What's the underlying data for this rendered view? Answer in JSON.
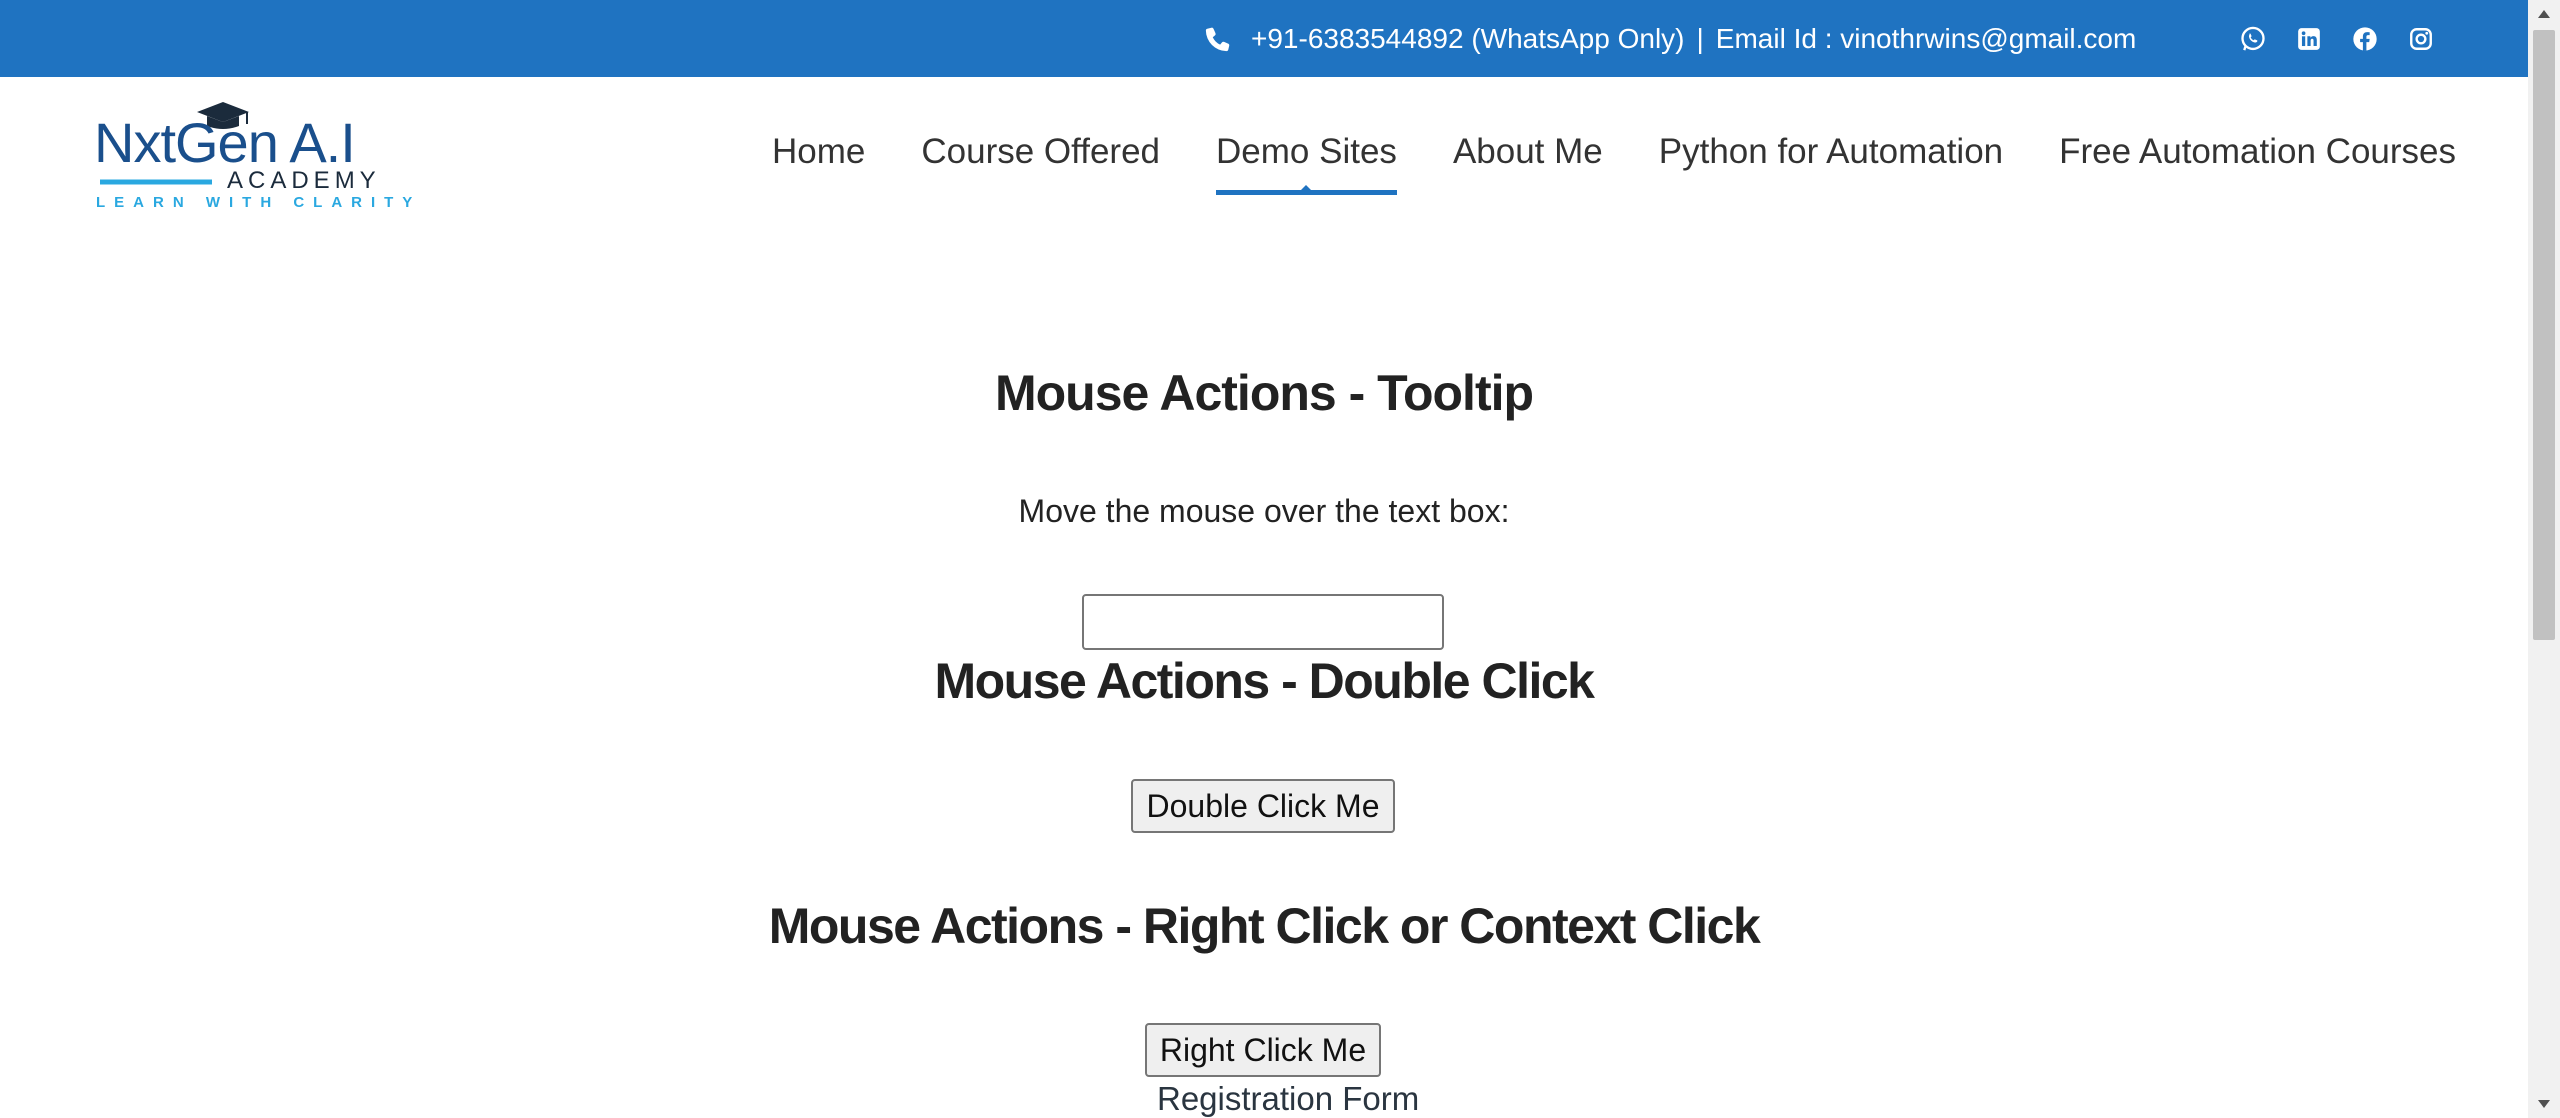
{
  "topbar": {
    "phone": "+91-6383544892 (WhatsApp Only)",
    "separator": "|",
    "email": "Email Id : vinothrwins@gmail.com",
    "bg_color": "#1f73c1",
    "phone_icon": "phone-icon",
    "socials": [
      "whatsapp-icon",
      "linkedin-icon",
      "facebook-icon",
      "instagram-icon"
    ]
  },
  "logo": {
    "brand": "NxtGen A.I",
    "subtitle": "ACADEMY",
    "tagline": "LEARN WITH CLARITY",
    "icon": "graduation-cap-icon"
  },
  "nav": {
    "items": [
      {
        "label": "Home"
      },
      {
        "label": "Course Offered"
      },
      {
        "label": "Demo Sites",
        "active": true
      },
      {
        "label": "About Me"
      },
      {
        "label": "Python for Automation"
      },
      {
        "label": "Free Automation Courses"
      }
    ]
  },
  "main": {
    "tooltip_heading": "Mouse Actions - Tooltip",
    "tooltip_instruction": "Move the mouse over the text box:",
    "tooltip_input_value": "",
    "double_click_heading": "Mouse Actions - Double Click",
    "double_click_button": "Double Click Me",
    "right_click_heading": "Mouse Actions - Right Click or Context Click",
    "right_click_button": "Right Click Me",
    "registration_link": "Registration Form"
  }
}
